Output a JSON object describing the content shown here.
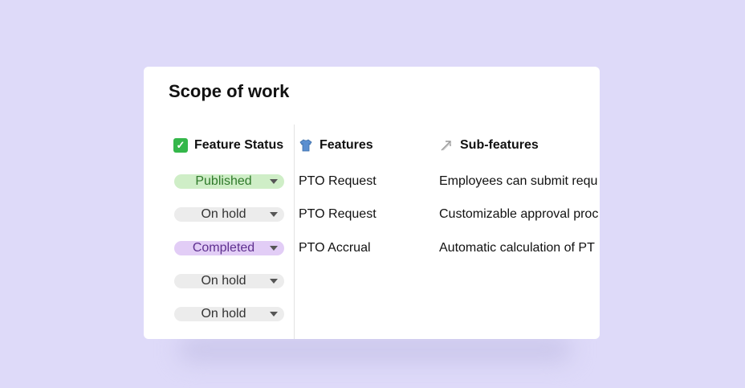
{
  "card": {
    "title": "Scope of work"
  },
  "headers": {
    "status": "Feature Status",
    "features": "Features",
    "subfeatures": "Sub-features"
  },
  "rows": [
    {
      "status": "Published",
      "status_color": "#cfeec7",
      "status_text_color": "#2f7a2a",
      "feature": "PTO Request",
      "subfeature": "Employees can submit requ"
    },
    {
      "status": "On hold",
      "status_color": "#ececec",
      "status_text_color": "#333333",
      "feature": "PTO Request",
      "subfeature": "Customizable approval proc"
    },
    {
      "status": "Completed",
      "status_color": "#e2cdf6",
      "status_text_color": "#5e2f8f",
      "feature": "PTO Accrual",
      "subfeature": "Automatic calculation of PT"
    },
    {
      "status": "On hold",
      "status_color": "#ececec",
      "status_text_color": "#333333",
      "feature": "",
      "subfeature": ""
    },
    {
      "status": "On hold",
      "status_color": "#ececec",
      "status_text_color": "#333333",
      "feature": "",
      "subfeature": ""
    }
  ],
  "icons": {
    "status": "check-box-icon",
    "features": "shirt-icon",
    "subfeatures": "link-arrow-icon"
  }
}
